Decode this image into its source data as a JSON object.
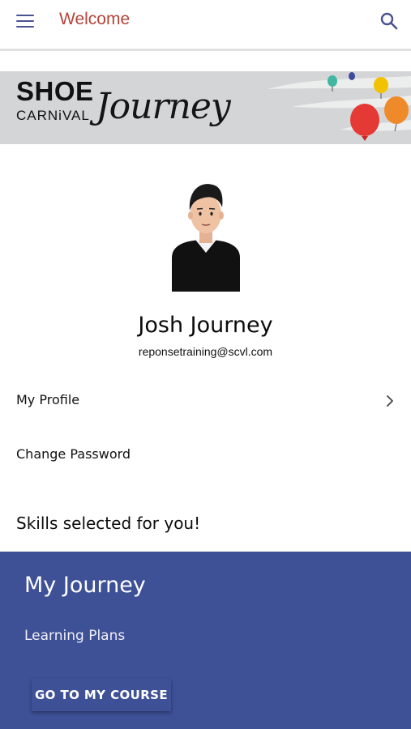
{
  "header": {
    "title": "Welcome",
    "menu_icon": "hamburger-menu-icon",
    "search_icon": "search-icon"
  },
  "banner": {
    "brand_line1": "SHOE",
    "brand_line2": "CARNiVAL",
    "brand_script": "Journey",
    "balloon_colors": [
      "#41b7a1",
      "#3e4a9c",
      "#f2c200",
      "#e53935",
      "#ef8a2a"
    ]
  },
  "profile": {
    "avatar_icon": "user-avatar-illustration",
    "name": "Josh Journey",
    "email": "reponsetraining@scvl.com"
  },
  "menu": {
    "items": [
      {
        "label": "My Profile",
        "icon": "chevron-right-icon"
      },
      {
        "label": "Change Password"
      }
    ]
  },
  "skills": {
    "heading": "Skills selected for you!"
  },
  "journey": {
    "title": "My Journey",
    "subtitle": "Learning Plans",
    "button_label": "GO TO MY COURSE",
    "background_color": "#3e5096"
  },
  "colors": {
    "header_title": "#b5443a",
    "header_icons": "#4a5290",
    "banner_bg": "#d4d5d7"
  }
}
